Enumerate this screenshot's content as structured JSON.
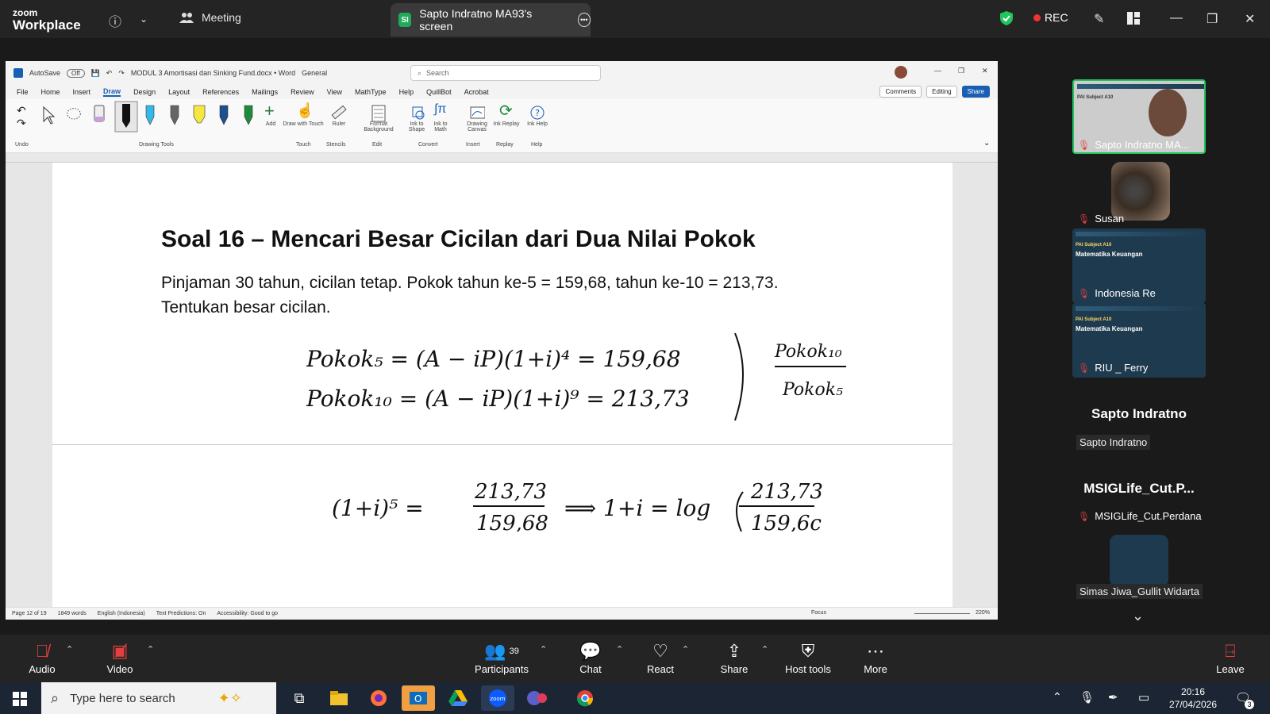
{
  "zoom": {
    "brand_small": "zoom",
    "brand_large": "Workplace",
    "meeting_label": "Meeting",
    "share_badge": "SI",
    "share_tab_label": "Sapto Indratno MA93's screen",
    "rec_label": "REC"
  },
  "word": {
    "autosave": "AutoSave",
    "autosave_state": "Off",
    "doc_name": "MODUL 3 Amortisasi dan Sinking Fund.docx • Word",
    "sensitivity": "General",
    "search_placeholder": "Search",
    "menu": [
      "File",
      "Home",
      "Insert",
      "Draw",
      "Design",
      "Layout",
      "References",
      "Mailings",
      "Review",
      "View",
      "MathType",
      "Help",
      "QuillBot",
      "Acrobat"
    ],
    "active_menu": "Draw",
    "comments": "Comments",
    "editing": "Editing",
    "share": "Share",
    "ribbon": {
      "undo": "Undo",
      "drawing_tools": "Drawing Tools",
      "add": "Add",
      "draw_with_touch": "Draw with Touch",
      "touch": "Touch",
      "ruler": "Ruler",
      "stencils": "Stencils",
      "format_background": "Format Background",
      "edit": "Edit",
      "ink_to_shape": "Ink to Shape",
      "ink_to_math": "Ink to Math",
      "convert": "Convert",
      "drawing_canvas": "Drawing Canvas",
      "insert": "Insert",
      "ink_replay": "Ink Replay",
      "replay": "Replay",
      "ink_help": "Ink Help",
      "help": "Help"
    },
    "document": {
      "title": "Soal 16 – Mencari Besar Cicilan dari Dua Nilai Pokok",
      "para_line1": "Pinjaman 30 tahun, cicilan tetap. Pokok tahun ke-5 = 159,68, tahun ke-10 = 213,73.",
      "para_line2": "Tentukan besar cicilan.",
      "ink": {
        "line1": "Pokok₅ = (A − iP)(1+i)⁴ = 159,68",
        "line2": "Pokok₁₀ = (A − iP)(1+i)⁹ = 213,73",
        "frac_top": "Pokok₁₀",
        "frac_bottom": "Pokok₅",
        "line3_left": "(1+i)⁵ =",
        "line3_num": "213,73",
        "line3_den": "159,68",
        "line3_right": "⟹ 1+i = log",
        "line3_num2": "213,73",
        "line3_den2": "159,6c"
      }
    },
    "status": {
      "page": "Page 12 of 19",
      "words": "1849 words",
      "lang": "English (Indonesia)",
      "predictions": "Text Predictions: On",
      "accessibility": "Accessibility: Good to go",
      "focus": "Focus",
      "zoom": "220%"
    }
  },
  "participants": {
    "tiles": [
      {
        "name": "Sapto Indratno MA..."
      },
      {
        "name": "Susan"
      },
      {
        "name": "Indonesia Re"
      },
      {
        "name": "RIU _ Ferry"
      }
    ],
    "slide_head": "PAI Subject A10",
    "slide_sub": "Matematika Keuangan",
    "heading1": "Sapto Indratno",
    "sub1": "Sapto Indratno",
    "heading2": "MSIGLife_Cut.P...",
    "sub2": "MSIGLife_Cut.Perdana",
    "sub3": "Simas Jiwa_Gullit Widarta"
  },
  "toolbar": {
    "audio": "Audio",
    "video": "Video",
    "participants": "Participants",
    "participants_count": "39",
    "chat": "Chat",
    "react": "React",
    "share": "Share",
    "host_tools": "Host tools",
    "more": "More",
    "leave": "Leave"
  },
  "taskbar": {
    "search_placeholder": "Type here to search",
    "time": "20:16",
    "date": "27/04/2026",
    "notif_count": "3"
  }
}
